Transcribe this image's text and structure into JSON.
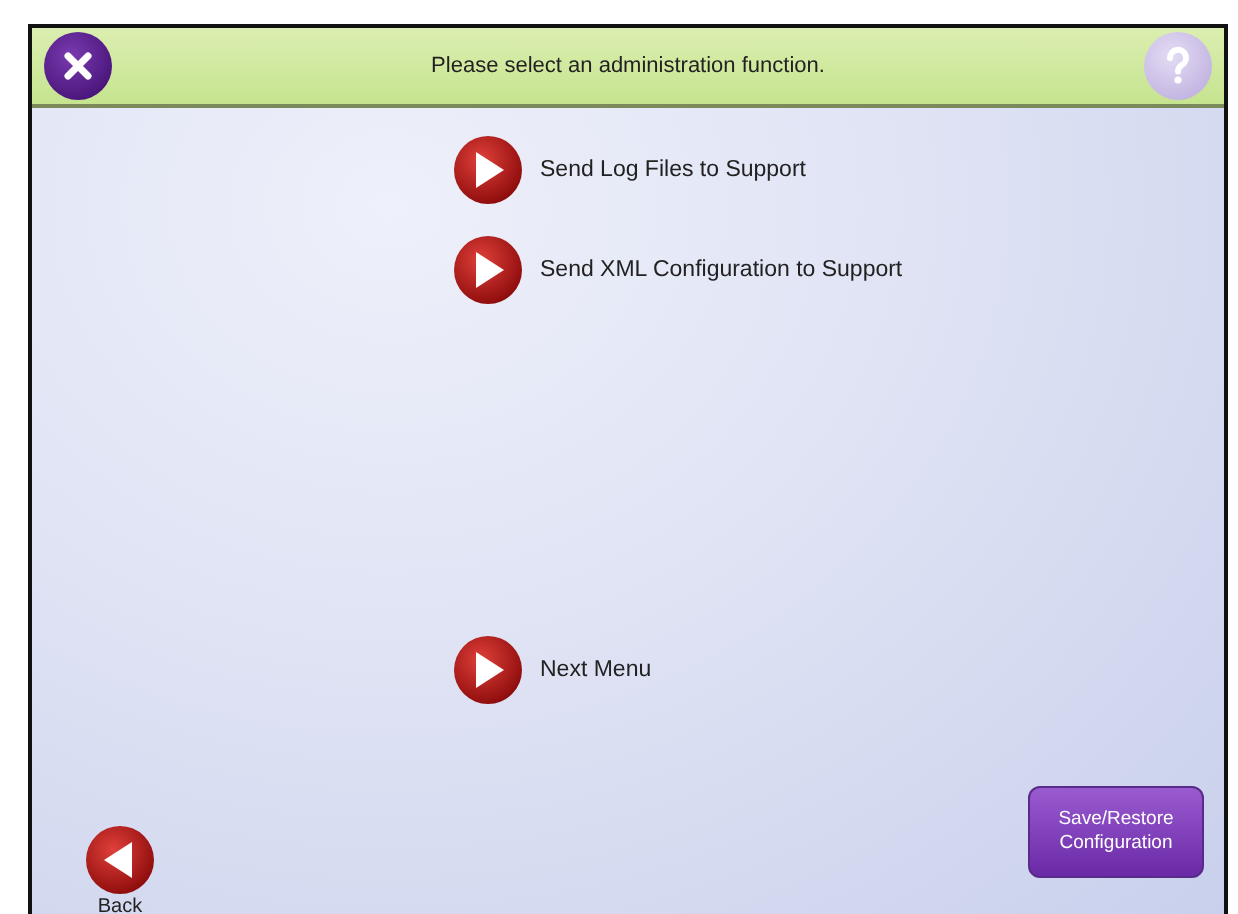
{
  "header": {
    "title": "Please select an administration function."
  },
  "top_items": [
    {
      "label": "Send Log Files to Support"
    },
    {
      "label": "Send XML Configuration to Support"
    }
  ],
  "bottom_items": [
    {
      "label": "Next Menu"
    }
  ],
  "back": {
    "label": "Back"
  },
  "save_restore": {
    "label": "Save/Restore Configuration"
  }
}
